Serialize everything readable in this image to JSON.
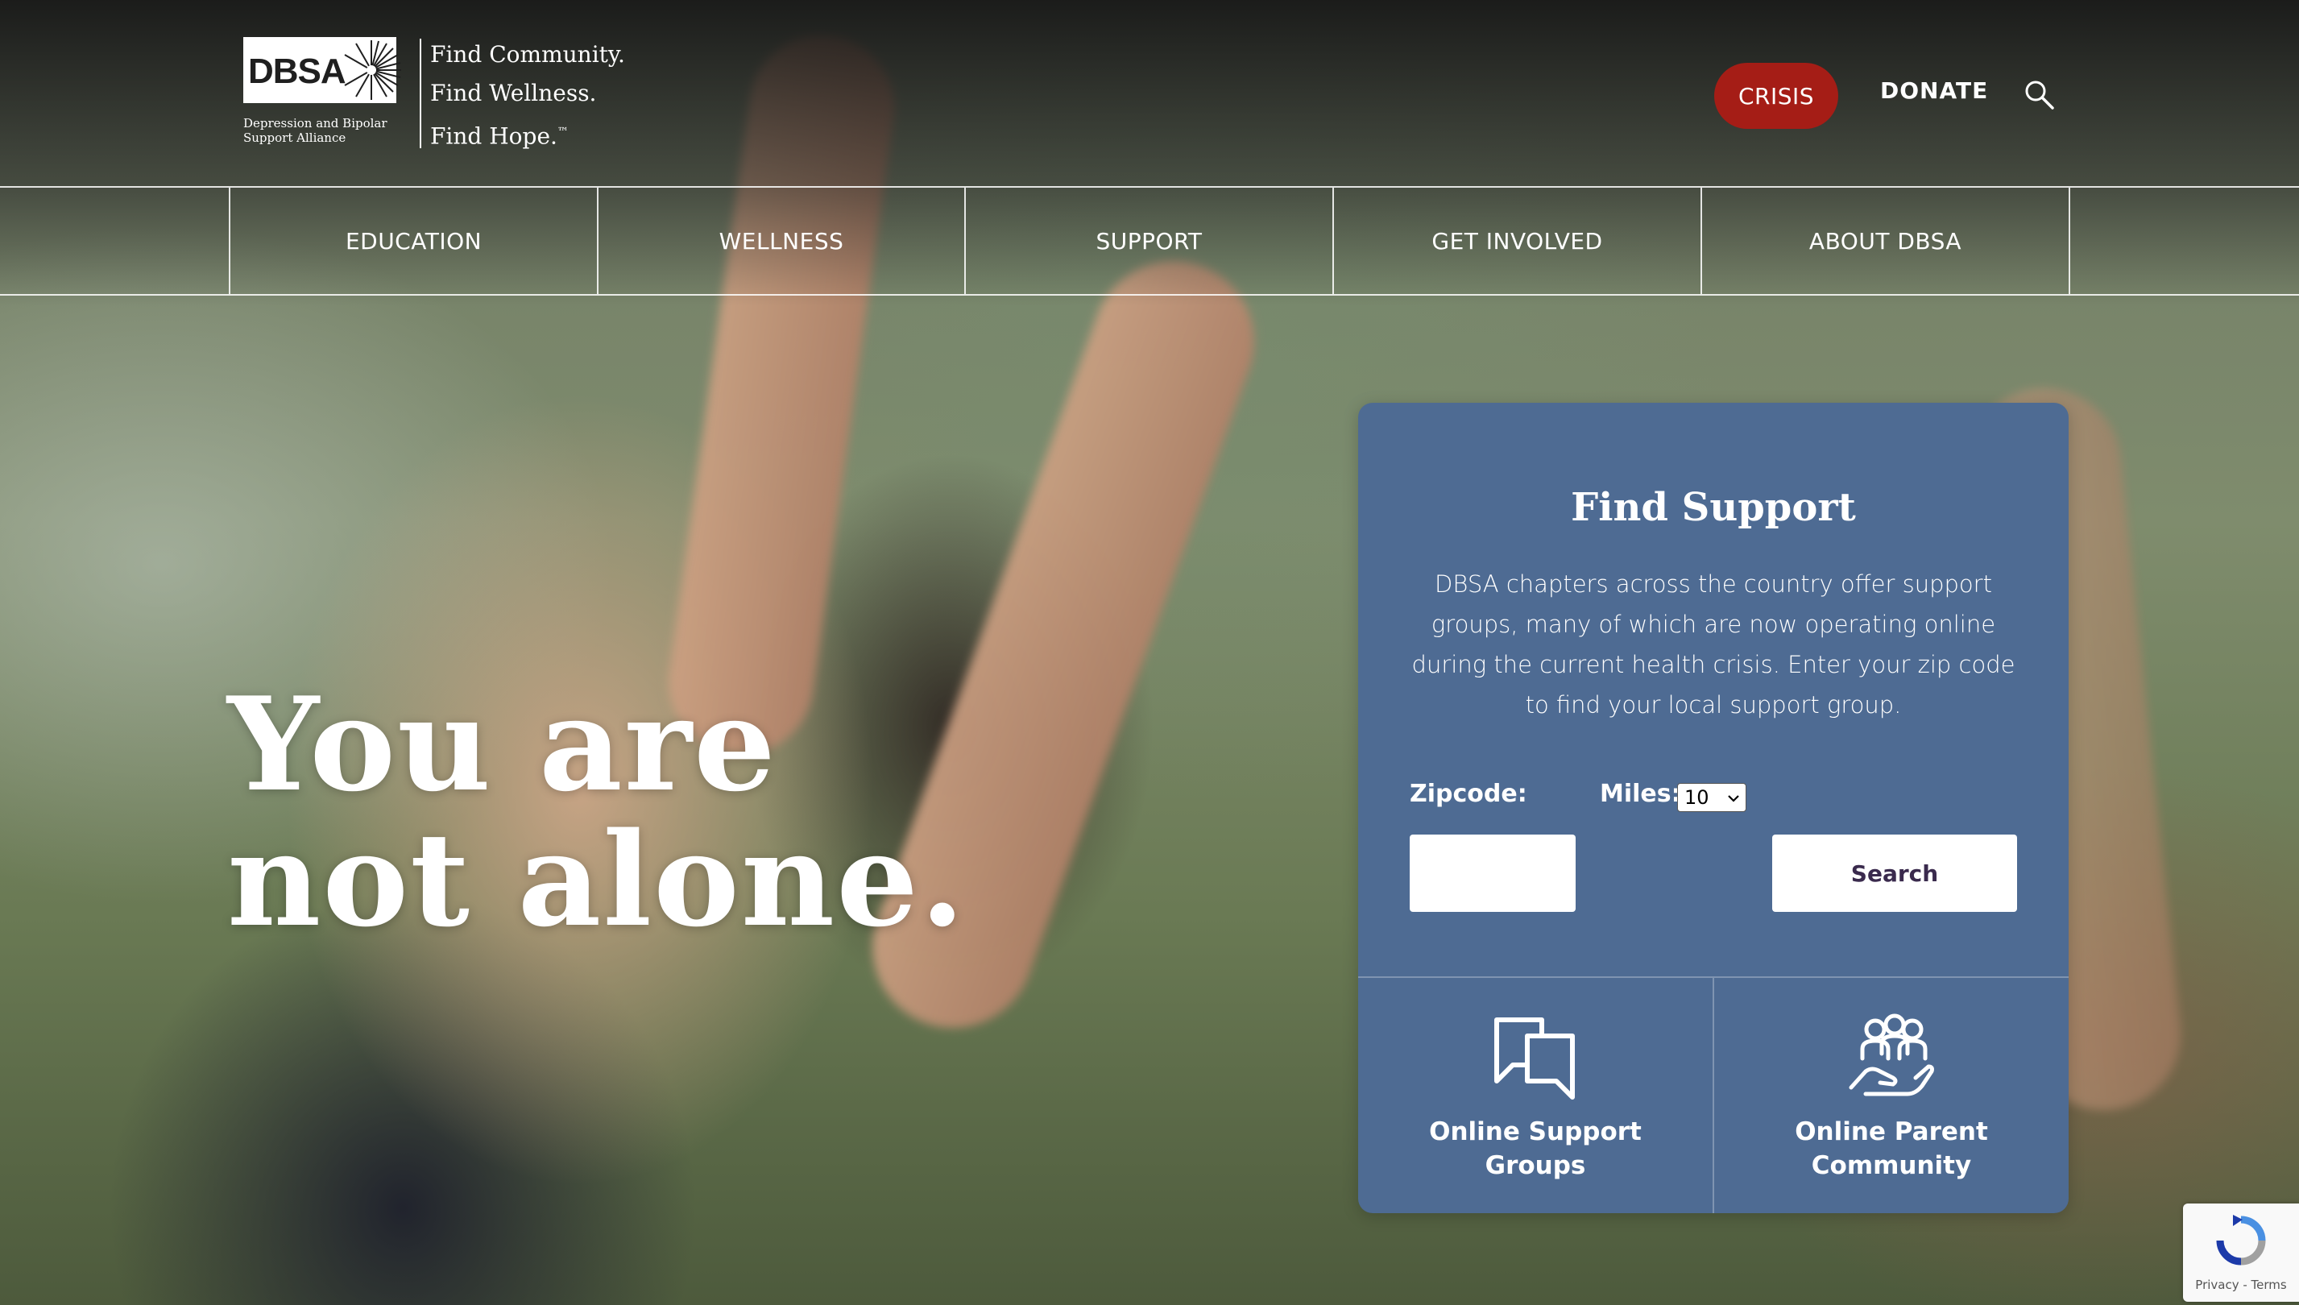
{
  "header": {
    "logo_text": "DBSA",
    "logo_subtitle": "Depression and Bipolar Support Alliance",
    "tagline": [
      "Find Community.",
      "Find Wellness.",
      "Find Hope."
    ],
    "tagline_tm": "™",
    "crisis_label": "CRISIS",
    "donate_label": "DONATE",
    "search_icon": "search-icon"
  },
  "nav": {
    "items": [
      {
        "label": "EDUCATION"
      },
      {
        "label": "WELLNESS"
      },
      {
        "label": "SUPPORT"
      },
      {
        "label": "GET INVOLVED"
      },
      {
        "label": "ABOUT DBSA"
      }
    ]
  },
  "hero": {
    "heading_line1": "You are",
    "heading_line2": "not alone."
  },
  "find_support": {
    "title": "Find Support",
    "description": "DBSA chapters across the country offer support groups, many of which are now operating online during the current health crisis. Enter your zip code to find your local support group.",
    "zipcode_label": "Zipcode:",
    "zipcode_value": "",
    "miles_label": "Miles:",
    "miles_selected": "10",
    "search_label": "Search",
    "links": [
      {
        "label_line1": "Online Support",
        "label_line2": "Groups",
        "icon": "chat-bubbles-icon"
      },
      {
        "label_line1": "Online Parent",
        "label_line2": "Community",
        "icon": "community-hand-icon"
      }
    ]
  },
  "recaptcha": {
    "text": "Privacy - Terms"
  },
  "colors": {
    "crisis_red": "#a51d16",
    "card_blue": "#4e6b93",
    "search_button_text": "#3a2a4d"
  }
}
